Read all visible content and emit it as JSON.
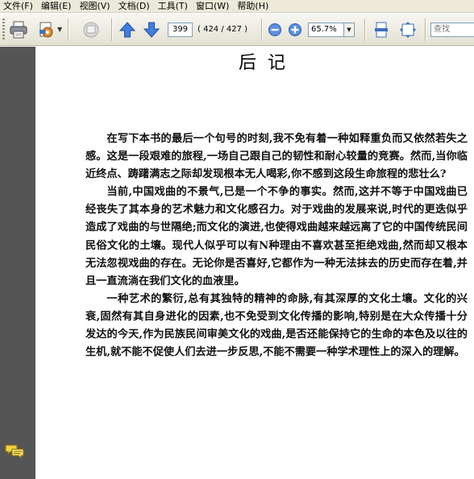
{
  "menu": {
    "items": [
      "文件(F)",
      "编辑(E)",
      "视图(V)",
      "文档(D)",
      "工具(T)",
      "窗口(W)",
      "帮助(H)"
    ]
  },
  "toolbar": {
    "page_current": "399",
    "page_count": "( 424 / 427 )",
    "zoom": "65.7%",
    "search_placeholder": "查找",
    "icons": [
      "print-icon",
      "settings-icon",
      "review-icon",
      "previous-page-icon",
      "next-page-icon",
      "zoom-out-icon",
      "zoom-in-icon",
      "fit-width-icon",
      "full-screen-icon"
    ]
  },
  "document": {
    "title": "后记",
    "paragraphs": [
      "在写下本书的最后一个句号的时刻,我不免有着一种如释重负而又依然若失之感。这是一段艰难的旅程,一场自己跟自己的韧性和耐心较量的竞赛。然而,当你临近终点、踌躇满志之际却发现根本无人喝彩,你不感到这段生命旅程的悲壮么?",
      "当前,中国戏曲的不景气,已是一个不争的事实。然而,这并不等于中国戏曲已经丧失了其本身的艺术魅力和文化感召力。对于戏曲的发展来说,时代的更迭似乎造成了戏曲的与世隔绝;而文化的演进,也使得戏曲越来越远离了它的中国传统民间民俗文化的土壤。现代人似乎可以有N种理由不喜欢甚至拒绝戏曲,然而却又根本无法忽视戏曲的存在。无论你是否喜好,它都作为一种无法抹去的历史而存在着,并且一直流淌在我们文化的血液里。",
      "一种艺术的繁衍,总有其独特的精神的命脉,有其深厚的文化土壤。文化的兴衰,固然有其自身进化的因素,也不免受到文化传播的影响,特别是在大众传播十分发达的今天,作为民族民间审美文化的戏曲,是否还能保持它的生命的本色及以往的生机,就不能不促使人们去进一步反思,不能不需要一种学术理性上的深入的理解。"
    ]
  },
  "left_panel": {
    "icon": "comments-icon"
  }
}
